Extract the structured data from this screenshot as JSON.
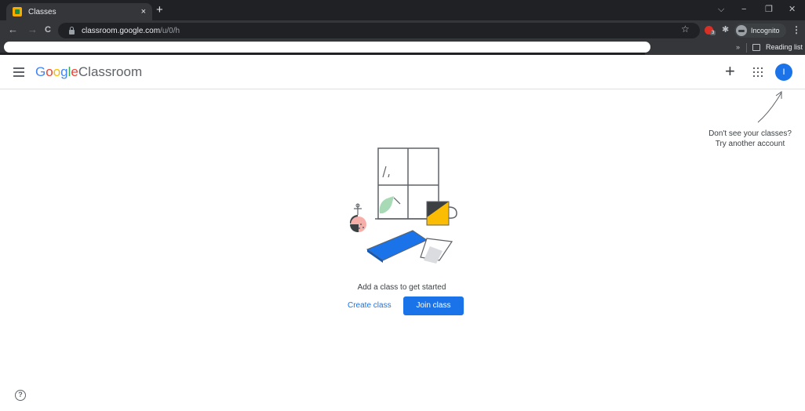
{
  "browser": {
    "tab": {
      "title": "Classes",
      "close": "×",
      "favicon": "classroom-favicon"
    },
    "new_tab": "+",
    "window_controls": {
      "dropdown": "⌵",
      "minimize": "−",
      "restore": "❐",
      "close": "✕"
    },
    "nav": {
      "back": "←",
      "forward": "→",
      "reload": "C"
    },
    "url": {
      "host": "classroom.google.com",
      "path": "/u/0/h"
    },
    "extension_badge": "3",
    "incognito_label": "Incognito",
    "bookmarks": {
      "chevron": "»",
      "reading_list": "Reading list"
    }
  },
  "header": {
    "logo": {
      "letters": [
        "G",
        "o",
        "o",
        "g",
        "l",
        "e"
      ],
      "product": "Classroom"
    },
    "plus": "+",
    "avatar_initial": "I"
  },
  "hint": {
    "line1": "Don't see your classes?",
    "line2": "Try another account"
  },
  "empty_state": {
    "message": "Add a class to get started",
    "create_label": "Create class",
    "join_label": "Join class"
  },
  "footer": {
    "help": "?"
  },
  "colors": {
    "google_blue": "#4285f4",
    "google_red": "#ea4335",
    "google_yellow": "#fbbc04",
    "google_green": "#34a853",
    "primary_button": "#1a73e8"
  }
}
